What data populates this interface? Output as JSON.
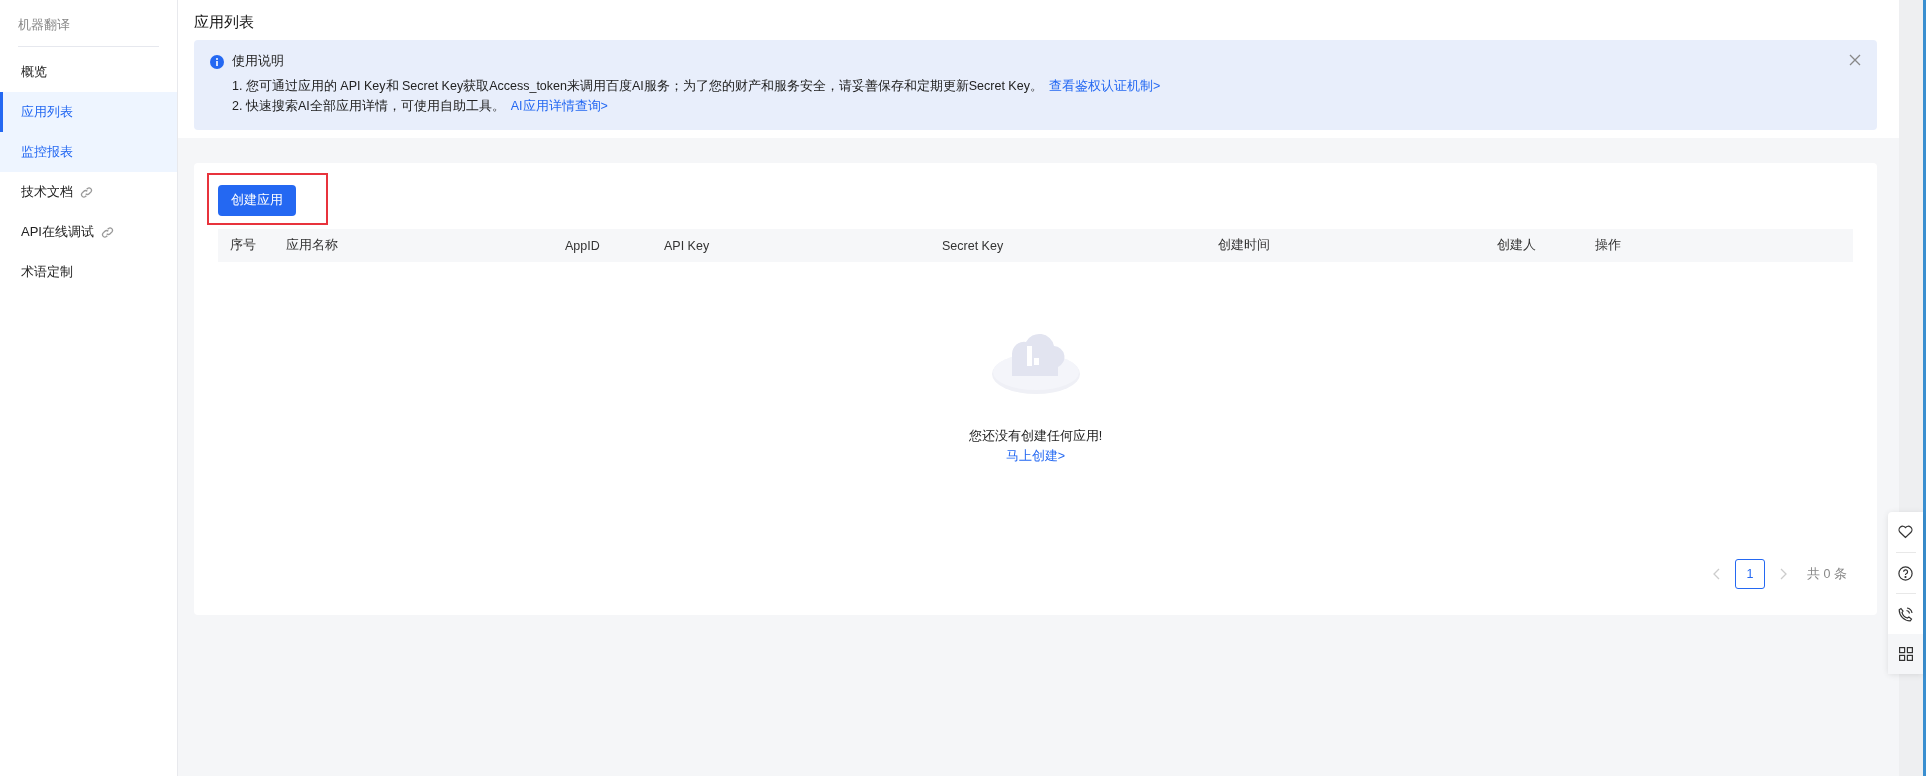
{
  "sidebar": {
    "title": "机器翻译",
    "items": [
      {
        "label": "概览",
        "selected": false,
        "highlighted": false,
        "external": false
      },
      {
        "label": "应用列表",
        "selected": true,
        "highlighted": false,
        "external": false
      },
      {
        "label": "监控报表",
        "selected": false,
        "highlighted": true,
        "external": false
      },
      {
        "label": "技术文档",
        "selected": false,
        "highlighted": false,
        "external": true
      },
      {
        "label": "API在线调试",
        "selected": false,
        "highlighted": false,
        "external": true
      },
      {
        "label": "术语定制",
        "selected": false,
        "highlighted": false,
        "external": false
      }
    ]
  },
  "page_title": "应用列表",
  "notice": {
    "title": "使用说明",
    "lines": [
      {
        "text": "1. 您可通过应用的 API Key和 Secret Key获取Access_token来调用百度AI服务；为了您的财产和服务安全，请妥善保存和定期更新Secret Key。",
        "link": "查看鉴权认证机制>"
      },
      {
        "text": "2. 快速搜索AI全部应用详情，可使用自助工具。",
        "link": "AI应用详情查询>"
      }
    ]
  },
  "create_button": "创建应用",
  "table": {
    "columns": [
      "序号",
      "应用名称",
      "AppID",
      "API Key",
      "Secret Key",
      "创建时间",
      "创建人",
      "操作"
    ]
  },
  "empty_state": {
    "message": "您还没有创建任何应用!",
    "link": "马上创建>"
  },
  "pagination": {
    "pages": [
      {
        "label": "1",
        "selected": true
      }
    ],
    "total": "共 0 条"
  }
}
